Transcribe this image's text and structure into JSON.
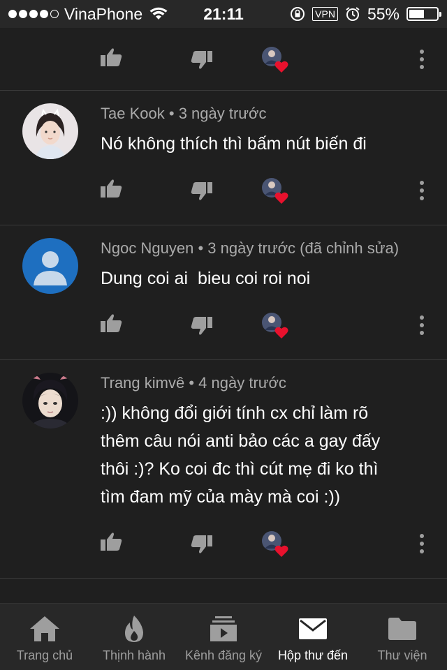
{
  "status_bar": {
    "carrier": "VinaPhone",
    "time": "21:11",
    "vpn": "VPN",
    "battery": "55%",
    "battery_level": 0.55
  },
  "comments": [
    {
      "author": "",
      "time": "",
      "lines": []
    },
    {
      "author": "Tae Kook",
      "time": "3 ngày trước",
      "lines": [
        "Nó không thích thì bấm nút biến đi"
      ]
    },
    {
      "author": "Ngoc Nguyen",
      "time": "3 ngày trước (đã chỉnh sửa)",
      "lines": [
        "Dung coi ai  bieu coi roi noi"
      ]
    },
    {
      "author": "Trang kimvê",
      "time": "4 ngày trước",
      "lines": [
        ":)) không đổi giới tính cx chỉ làm rõ",
        "thêm câu nói anti bảo các a gay đấy",
        "thôi :)? Ko coi đc thì cút mẹ đi ko thì",
        "tìm đam mỹ của mày mà coi :))"
      ]
    }
  ],
  "separator": "•",
  "nav": {
    "home": "Trang chủ",
    "trending": "Thịnh hành",
    "subscriptions": "Kênh đăng ký",
    "inbox": "Hộp thư đến",
    "library": "Thư viện",
    "active": "inbox"
  },
  "colors": {
    "background": "#1f1f1f",
    "bar": "#282828",
    "heart": "#e8112d",
    "meta_text": "#aaaaaa",
    "icon": "#9e9e9e"
  }
}
